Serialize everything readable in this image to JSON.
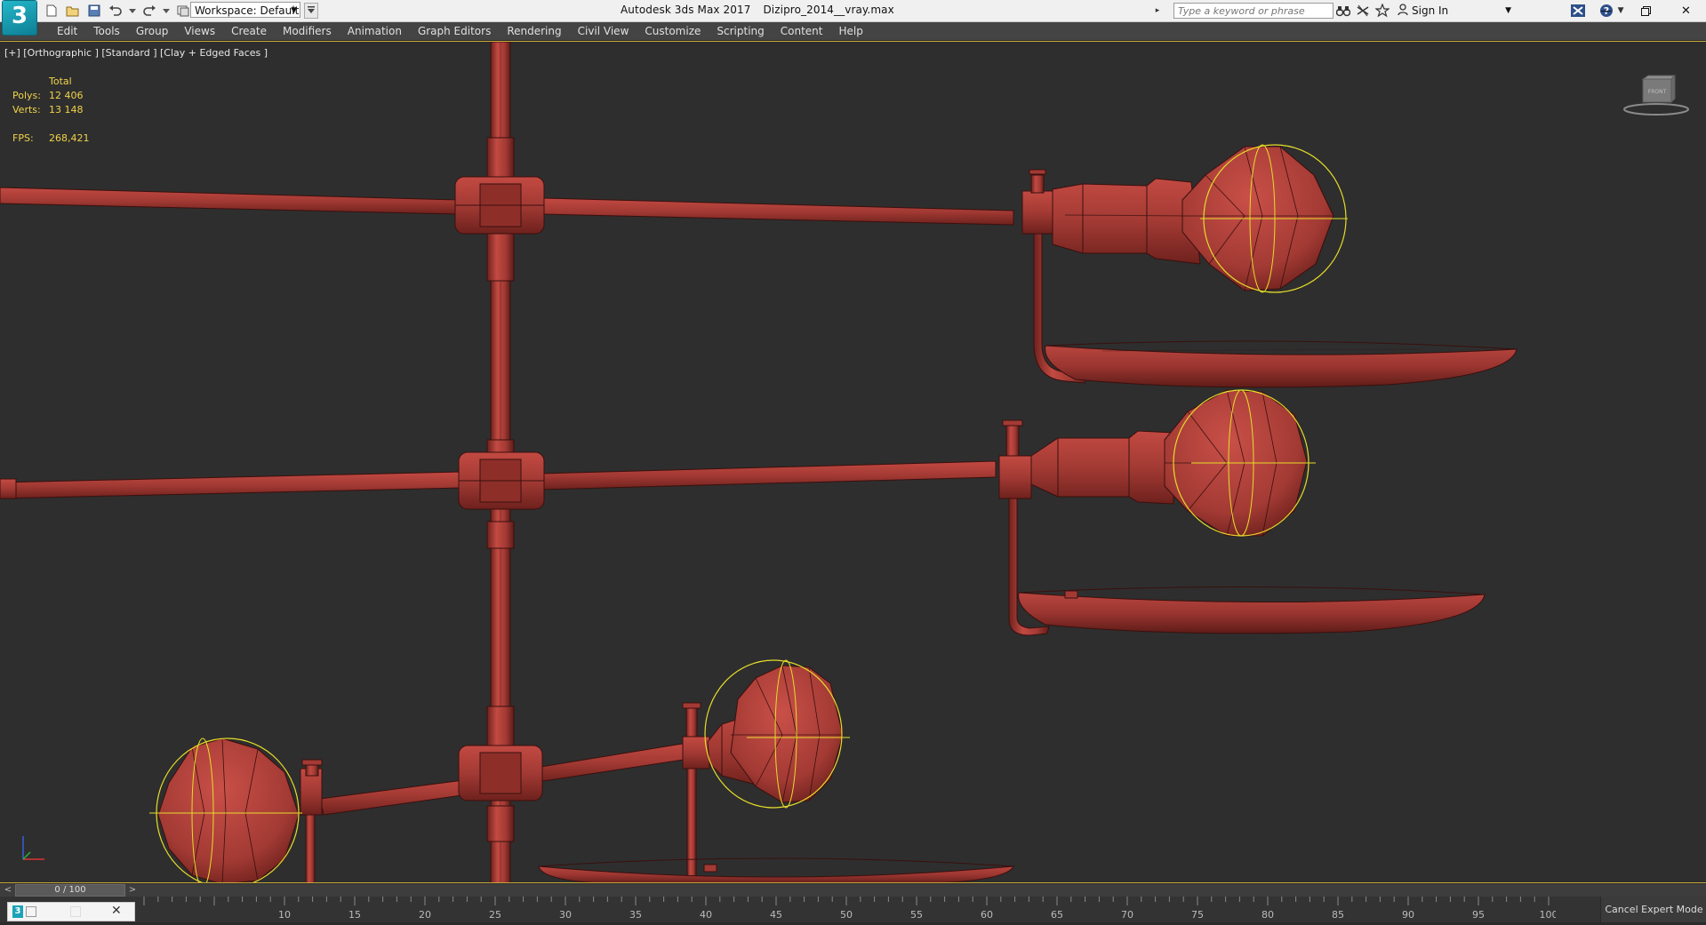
{
  "titlebar": {
    "app_name": "Autodesk 3ds Max 2017",
    "file_name": "Dizipro_2014__vray.max",
    "workspace_label": "Workspace: Default",
    "search_placeholder": "Type a keyword or phrase",
    "sign_in": "Sign In",
    "logo_text": "3"
  },
  "menu": [
    "Edit",
    "Tools",
    "Group",
    "Views",
    "Create",
    "Modifiers",
    "Animation",
    "Graph Editors",
    "Rendering",
    "Civil View",
    "Customize",
    "Scripting",
    "Content",
    "Help"
  ],
  "viewport": {
    "label": "[+] [Orthographic ] [Standard ] [Clay + Edged Faces ]",
    "stats": {
      "header": "Total",
      "polys_label": "Polys:",
      "polys": "12 406",
      "verts_label": "Verts:",
      "verts": "13 148",
      "fps_label": "FPS:",
      "fps": "268,421"
    },
    "viewcube_label": "FRONT"
  },
  "timeline": {
    "frame": "0 / 100",
    "ticks": [
      "10",
      "15",
      "20",
      "25",
      "30",
      "35",
      "40",
      "45",
      "50",
      "55",
      "60",
      "65",
      "70",
      "75",
      "80",
      "85",
      "90",
      "95",
      "100"
    ]
  },
  "status": {
    "cancel_expert": "Cancel Expert Mode"
  },
  "colors": {
    "model": "#a33a34",
    "model_dark": "#6e211d",
    "model_light": "#c24a42",
    "selection": "#e6dd2a",
    "viewport_bg": "#2e2e2e",
    "viewport_border": "#c7a93a"
  }
}
